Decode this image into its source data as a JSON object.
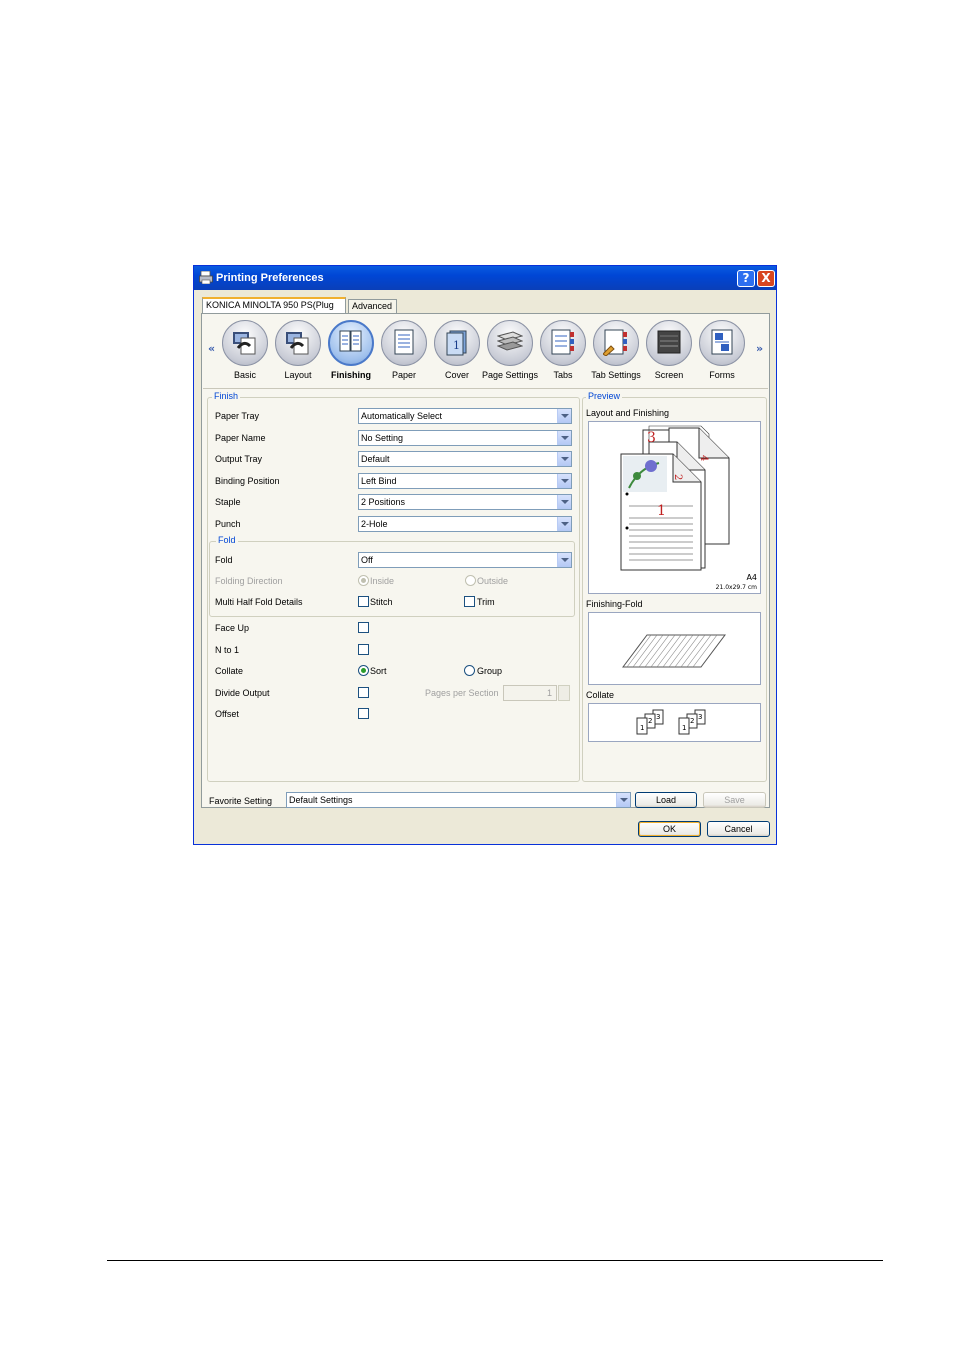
{
  "window": {
    "title": "Printing Preferences",
    "help_btn": "?",
    "close_btn": "X"
  },
  "tabs": [
    {
      "label": "KONICA MINOLTA 950 PS(Plug"
    },
    {
      "label": "Advanced"
    }
  ],
  "toolbar": {
    "scroll_left": "«",
    "scroll_right": "»",
    "items": [
      {
        "label": "Basic",
        "icon": "printer-basic-icon"
      },
      {
        "label": "Layout",
        "icon": "printer-layout-icon"
      },
      {
        "label": "Finishing",
        "icon": "finishing-icon",
        "selected": true
      },
      {
        "label": "Paper",
        "icon": "paper-icon"
      },
      {
        "label": "Cover",
        "icon": "cover-icon"
      },
      {
        "label": "Page Settings",
        "icon": "page-settings-icon"
      },
      {
        "label": "Tabs",
        "icon": "tabs-icon"
      },
      {
        "label": "Tab Settings",
        "icon": "tab-settings-icon"
      },
      {
        "label": "Screen",
        "icon": "screen-icon"
      },
      {
        "label": "Forms",
        "icon": "forms-icon"
      }
    ]
  },
  "finish": {
    "group_title": "Finish",
    "paper_tray": {
      "label": "Paper Tray",
      "value": "Automatically Select"
    },
    "paper_name": {
      "label": "Paper Name",
      "value": "No Setting"
    },
    "output_tray": {
      "label": "Output Tray",
      "value": "Default"
    },
    "binding_position": {
      "label": "Binding Position",
      "value": "Left Bind"
    },
    "staple": {
      "label": "Staple",
      "value": "2 Positions"
    },
    "punch": {
      "label": "Punch",
      "value": "2-Hole"
    }
  },
  "fold": {
    "group_title": "Fold",
    "fold": {
      "label": "Fold",
      "value": "Off"
    },
    "folding_direction": {
      "label": "Folding Direction",
      "inside": "Inside",
      "outside": "Outside"
    },
    "multi_half": {
      "label": "Multi Half Fold Details",
      "stitch": "Stitch",
      "trim": "Trim"
    }
  },
  "options": {
    "face_up": {
      "label": "Face Up",
      "checked": false
    },
    "n_to_1": {
      "label": "N to 1",
      "checked": false
    },
    "collate": {
      "label": "Collate",
      "sort": "Sort",
      "group": "Group",
      "selected": "Sort"
    },
    "divide_output": {
      "label": "Divide Output",
      "checked": false,
      "pages_per_section_label": "Pages per Section",
      "pages_per_section": "1"
    },
    "offset": {
      "label": "Offset",
      "checked": false
    }
  },
  "preview": {
    "group_title": "Preview",
    "layout_label": "Layout and Finishing",
    "paper_size": "A4",
    "paper_dims": "21.0x29.7 cm",
    "page_numbers": [
      "3",
      "4",
      "2",
      "1"
    ],
    "fold_label": "Finishing-Fold",
    "collate_label": "Collate",
    "collate_numbers": [
      "1",
      "2",
      "3",
      "1",
      "2",
      "3"
    ]
  },
  "footer": {
    "favorite_label": "Favorite Setting",
    "favorite_value": "Default Settings",
    "load": "Load",
    "save": "Save",
    "ok": "OK",
    "cancel": "Cancel"
  },
  "colors": {
    "title_bar": "#0a5be0",
    "accent": "#0046d5",
    "page_number": "#c02020"
  }
}
